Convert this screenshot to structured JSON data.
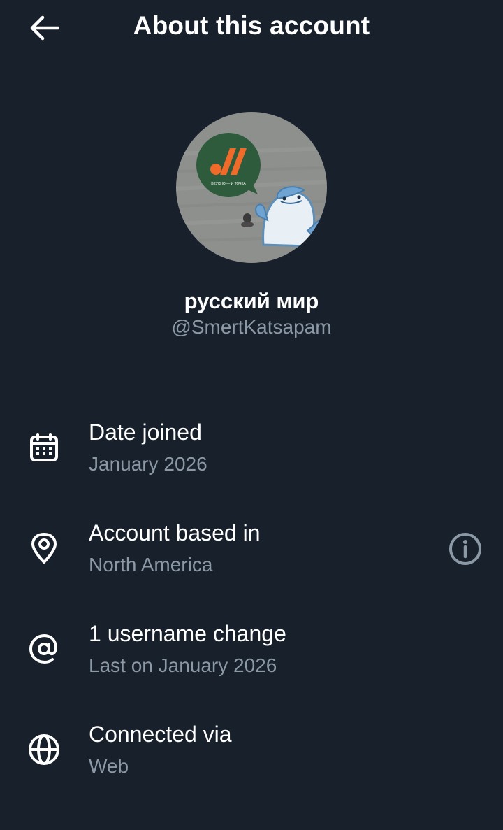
{
  "header": {
    "title": "About this account",
    "back_icon": "arrow-left-icon"
  },
  "profile": {
    "display_name": "русский мир",
    "handle": "@SmertKatsapam",
    "avatar_logo_text": "ВКУСНО — И ТОЧКА"
  },
  "details": [
    {
      "icon": "calendar-icon",
      "label": "Date joined",
      "value": "January 2026"
    },
    {
      "icon": "location-pin-icon",
      "label": "Account based in",
      "value": "North America",
      "action_icon": "info-icon"
    },
    {
      "icon": "at-sign-icon",
      "label": "1 username change",
      "value": "Last on January 2026"
    },
    {
      "icon": "globe-icon",
      "label": "Connected via",
      "value": "Web"
    }
  ],
  "colors": {
    "background": "#17202b",
    "primary_text": "#ffffff",
    "secondary_text": "#8b98a5",
    "logo_green": "#2e5b3c",
    "logo_orange": "#f06a2a"
  }
}
